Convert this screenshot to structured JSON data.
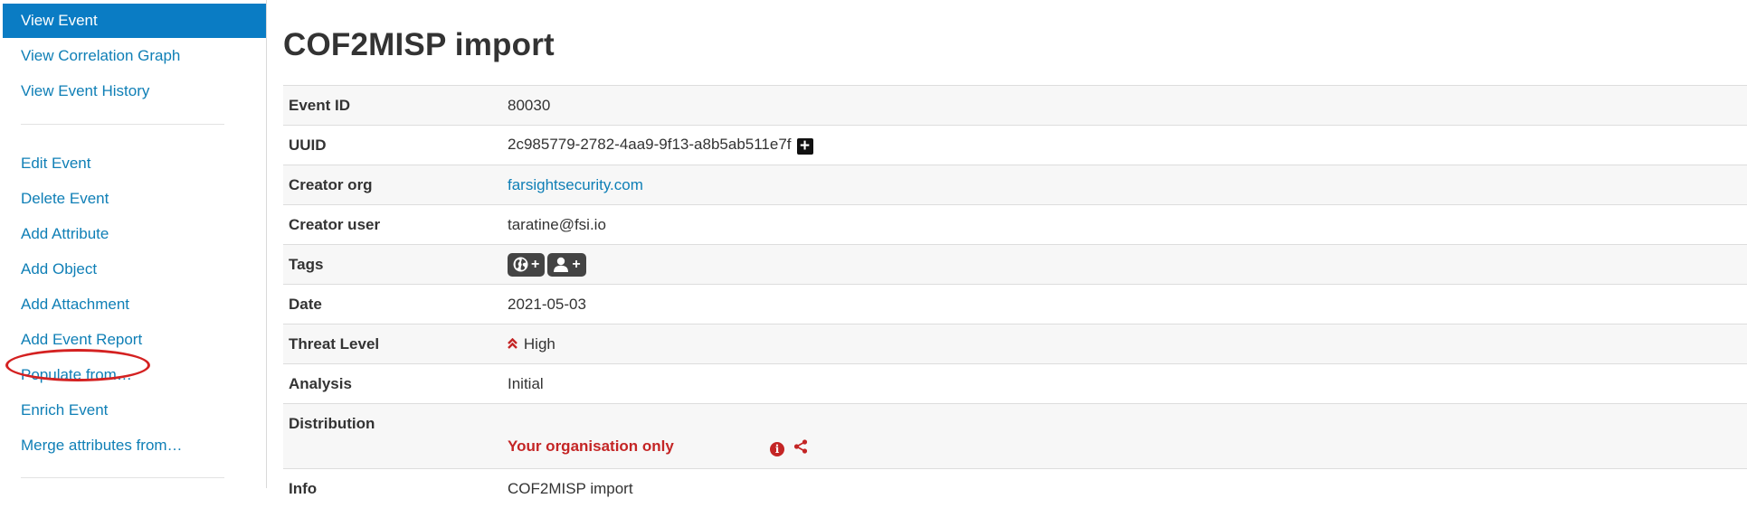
{
  "sidebar": {
    "items": [
      {
        "label": "View Event",
        "active": true
      },
      {
        "label": "View Correlation Graph"
      },
      {
        "label": "View Event History"
      },
      {
        "label": "Edit Event"
      },
      {
        "label": "Delete Event"
      },
      {
        "label": "Add Attribute"
      },
      {
        "label": "Add Object"
      },
      {
        "label": "Add Attachment"
      },
      {
        "label": "Add Event Report"
      },
      {
        "label": "Populate from…",
        "highlighted": true
      },
      {
        "label": "Enrich Event"
      },
      {
        "label": "Merge attributes from…"
      }
    ]
  },
  "event": {
    "title": "COF2MISP import",
    "rows": {
      "event_id": {
        "key": "Event ID",
        "value": "80030"
      },
      "uuid": {
        "key": "UUID",
        "value": "2c985779-2782-4aa9-9f13-a8b5ab511e7f"
      },
      "creator_org": {
        "key": "Creator org",
        "value": "farsightsecurity.com"
      },
      "creator_user": {
        "key": "Creator user",
        "value": "taratine@fsi.io"
      },
      "tags": {
        "key": "Tags",
        "global_tag_icon": "globe-icon",
        "local_tag_icon": "user-icon",
        "plus": "+"
      },
      "date": {
        "key": "Date",
        "value": "2021-05-03"
      },
      "threat_level": {
        "key": "Threat Level",
        "value": "High",
        "icon": "double-chevron-up-icon"
      },
      "analysis": {
        "key": "Analysis",
        "value": "Initial"
      },
      "distribution": {
        "key": "Distribution",
        "value": "Your organisation only",
        "icons": [
          "info-icon",
          "share-icon"
        ]
      },
      "info": {
        "key": "Info",
        "value": "COF2MISP import"
      }
    }
  },
  "colors": {
    "link": "#0f7fb6",
    "active_menu": "#0a7cc4",
    "danger": "#c42525",
    "highlight_ring": "#d42121"
  }
}
